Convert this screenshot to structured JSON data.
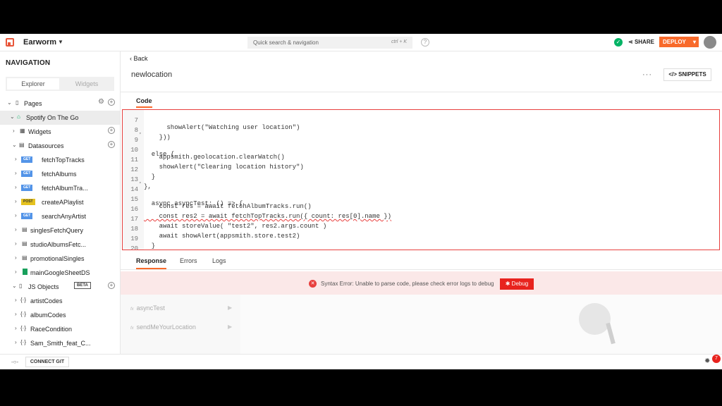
{
  "header": {
    "app_name": "Earworm",
    "search_placeholder": "Quick search & navigation",
    "search_shortcut": "ctrl + K",
    "help": "?",
    "share_label": "SHARE",
    "deploy_label": "DEPLOY"
  },
  "sidebar": {
    "title": "NAVIGATION",
    "tab_explorer": "Explorer",
    "tab_widgets": "Widgets",
    "items": [
      {
        "label": "Pages"
      },
      {
        "label": "Spotify On The Go"
      },
      {
        "label": "Widgets"
      },
      {
        "label": "Datasources"
      },
      {
        "label": "fetchTopTracks",
        "method": "GET"
      },
      {
        "label": "fetchAlbums",
        "method": "GET"
      },
      {
        "label": "fetchAlbumTra...",
        "method": "GET"
      },
      {
        "label": "createAPlaylist",
        "method": "POST"
      },
      {
        "label": "searchAnyArtist",
        "method": "GET"
      },
      {
        "label": "singlesFetchQuery"
      },
      {
        "label": "studioAlbumsFetc..."
      },
      {
        "label": "promotionalSingles"
      },
      {
        "label": "mainGoogleSheetDS"
      },
      {
        "label": "JS Objects",
        "badge": "BETA"
      },
      {
        "label": "artistCodes"
      },
      {
        "label": "albumCodes"
      },
      {
        "label": "RaceCondition"
      },
      {
        "label": "Sam_Smith_feat_C..."
      }
    ]
  },
  "main": {
    "back_label": "Back",
    "page_title": "newlocation",
    "snippets_label": "SNIPPETS",
    "code_tab": "Code",
    "code_lines": [
      {
        "n": "7",
        "text": "      showAlert(\"Watching user location\")"
      },
      {
        "n": "8",
        "text": "    }))"
      },
      {
        "n": "9",
        "text": "  else {"
      },
      {
        "n": "10",
        "text": "    appsmith.geolocation.clearWatch()"
      },
      {
        "n": "11",
        "text": "    showAlert(\"Clearing location history\")"
      },
      {
        "n": "12",
        "text": "  }"
      },
      {
        "n": "13",
        "text": "},"
      },
      {
        "n": "14",
        "text": "  async asyncTest: () => {"
      },
      {
        "n": "15",
        "text": "    const res = await fetchAlbumTracks.run()"
      },
      {
        "n": "16",
        "text": "    const res2 = await fetchTopTracks.run({ count: res[0].name })"
      },
      {
        "n": "17",
        "text": "    await storeValue( \"test2\", res2.args.count )"
      },
      {
        "n": "18",
        "text": "    await showAlert(appsmith.store.test2)"
      },
      {
        "n": "19",
        "text": "  }"
      },
      {
        "n": "20",
        "text": "}"
      }
    ],
    "response_tabs": [
      "Response",
      "Errors",
      "Logs"
    ],
    "error_text": "Syntax Error: Unable to parse code, please check error logs to debug",
    "debug_label": "Debug",
    "functions": [
      "asyncTest",
      "sendMeYourLocation"
    ],
    "fx": "fx"
  },
  "footer": {
    "connect_git": "CONNECT GIT",
    "error_count": "7"
  }
}
